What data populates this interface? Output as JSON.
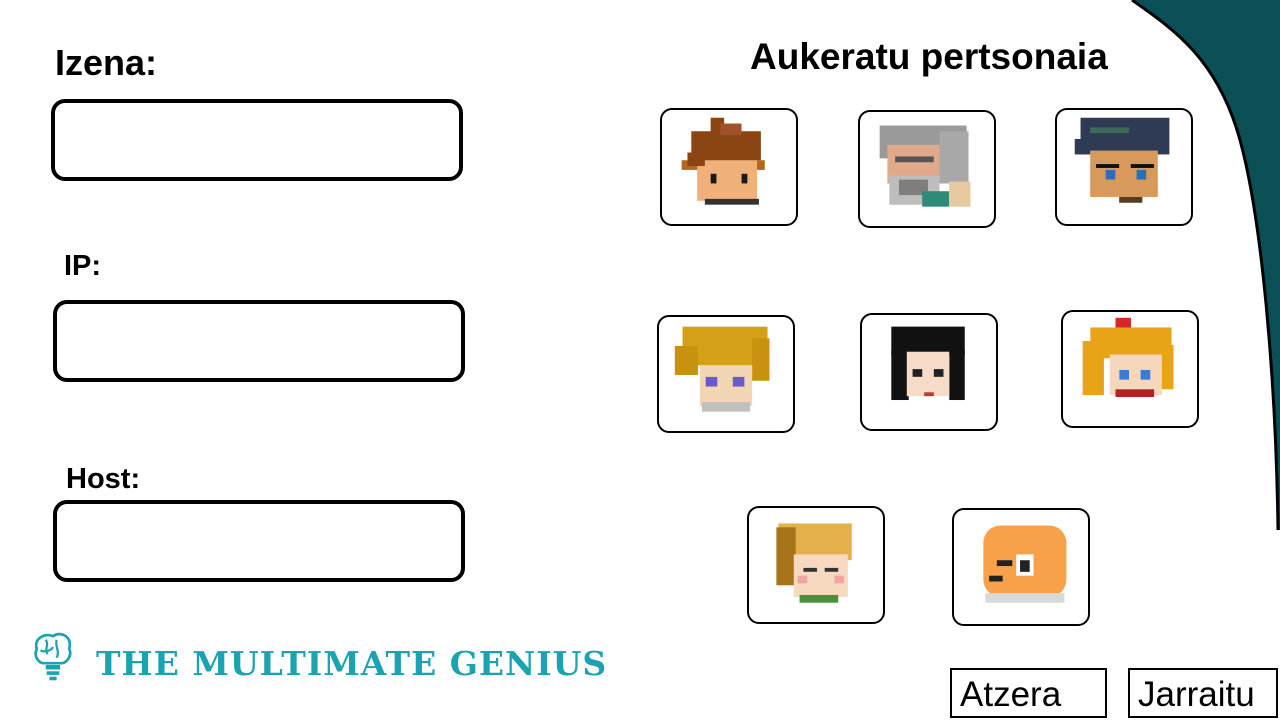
{
  "form": {
    "name_label": "Izena:",
    "name_value": "",
    "ip_label": "IP:",
    "ip_value": "",
    "host_label": "Host:",
    "host_value": ""
  },
  "character_select": {
    "heading": "Aukeratu pertsonaia",
    "characters": [
      {
        "id": "char-brown-spiky-hair"
      },
      {
        "id": "char-grey-beard-elder"
      },
      {
        "id": "char-dark-hair-boy"
      },
      {
        "id": "char-golden-hair"
      },
      {
        "id": "char-black-hair-girl"
      },
      {
        "id": "char-orange-hair-bow"
      },
      {
        "id": "char-blond-bob"
      },
      {
        "id": "char-orange-round-head"
      }
    ]
  },
  "buttons": {
    "back_label": "Atzera",
    "continue_label": "Jarraitu"
  },
  "logo": {
    "text": "THE MULTIMATE GENIUS",
    "icon": "brain-lightbulb-icon"
  },
  "colors": {
    "accent_corner": "#0b4f57",
    "logo": "#1aa3b0"
  }
}
